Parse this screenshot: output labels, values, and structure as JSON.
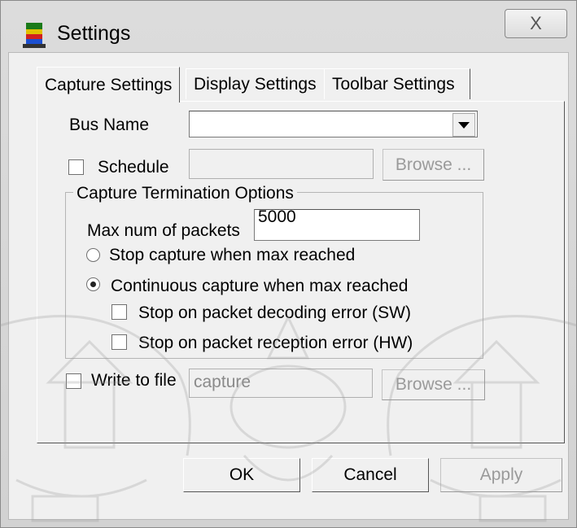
{
  "window": {
    "title": "Settings",
    "close_glyph": "X"
  },
  "tabs": [
    {
      "label": "Capture Settings",
      "selected": true
    },
    {
      "label": "Display Settings",
      "selected": false
    },
    {
      "label": "Toolbar Settings",
      "selected": false
    }
  ],
  "capture": {
    "bus_name_label": "Bus Name",
    "bus_name_value": "",
    "schedule_label": "Schedule",
    "schedule_checked": false,
    "schedule_value": "",
    "schedule_browse_label": "Browse ...",
    "termination_group_title": "Capture Termination Options",
    "max_packets_label": "Max num of packets",
    "max_packets_value": "5000",
    "stop_capture_label": "Stop capture when max reached",
    "continuous_capture_label": "Continuous capture when max reached",
    "selected_mode": "continuous",
    "stop_decoding_error_label": "Stop on packet decoding error (SW)",
    "stop_reception_error_label": "Stop on packet reception error (HW)",
    "write_to_file_label": "Write to file",
    "write_to_file_checked": false,
    "file_value": "capture",
    "file_browse_label": "Browse ..."
  },
  "buttons": {
    "ok": "OK",
    "cancel": "Cancel",
    "apply": "Apply"
  },
  "icons": {
    "app": "settings-app-icon",
    "close": "close-icon",
    "dropdown": "chevron-down-icon"
  }
}
